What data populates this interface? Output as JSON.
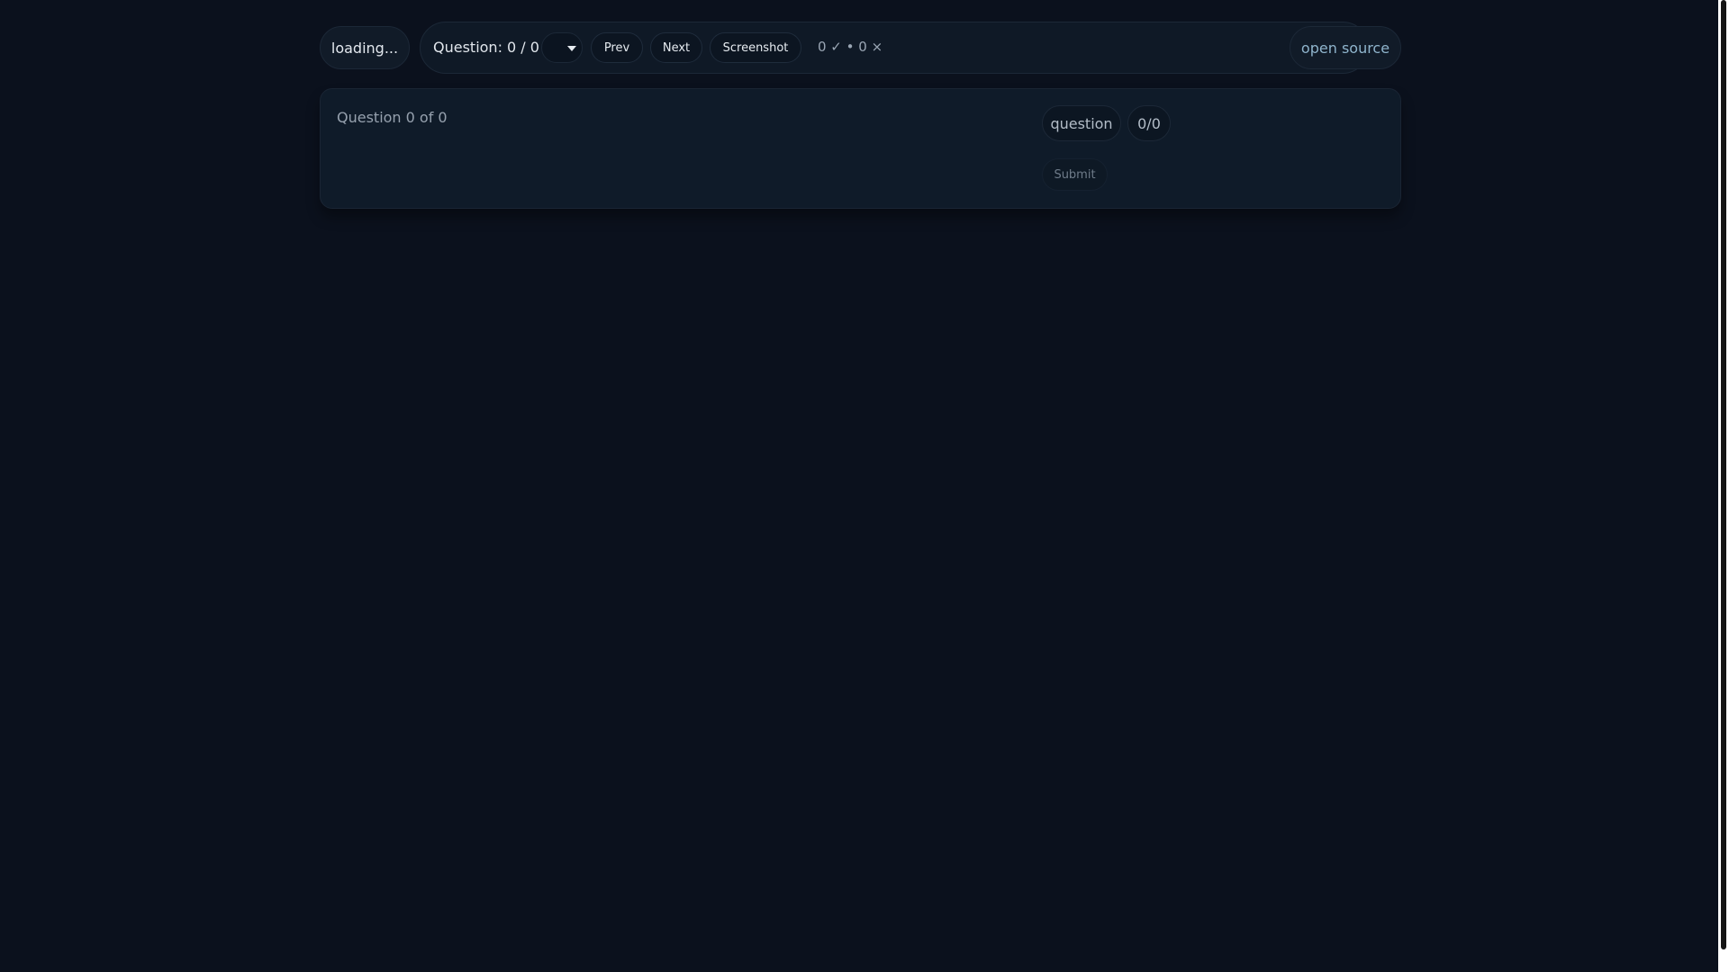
{
  "header": {
    "loading_label": "loading...",
    "question_label": "Question: 0 / 0",
    "question_select_value": "",
    "prev_label": "Prev",
    "next_label": "Next",
    "screenshot_label": "Screenshot",
    "score_text": "0 ✓ • 0 ×",
    "open_source_label": "open source"
  },
  "main": {
    "question_count": "Question 0 of 0",
    "type_tag": "question",
    "progress_tag": "0/0",
    "submit_label": "Submit"
  },
  "colors": {
    "background": "#0b111d",
    "panel": "#0f1b29",
    "link": "#8fb4cc"
  },
  "icons": {
    "select_chevron": "chevron-down-icon"
  }
}
